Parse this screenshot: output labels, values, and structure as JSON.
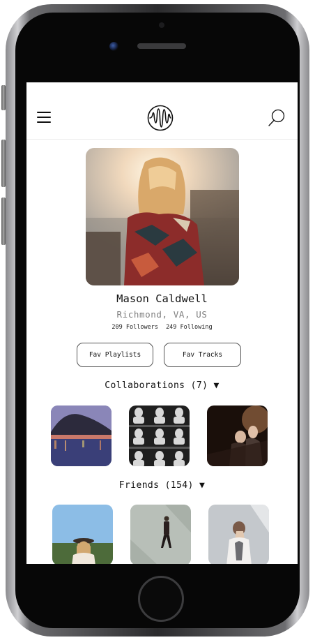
{
  "profile": {
    "name": "Mason Caldwell",
    "location": "Richmond, VA, US",
    "followers": "209 Followers",
    "following": "249 Following"
  },
  "buttons": {
    "fav_playlists": "Fav Playlists",
    "fav_tracks": "Fav Tracks"
  },
  "collaborations": {
    "title": "Collaborations (7) ▼",
    "items": [
      "lake-city-night",
      "statue-busts",
      "concert-crowd"
    ]
  },
  "friends": {
    "title": "Friends (154) ▼",
    "items": [
      "woman-hat-sky",
      "man-walking-street",
      "woman-grey-sky"
    ]
  },
  "icons": {
    "menu": "hamburger-menu-icon",
    "logo": "soundwave-logo-icon",
    "search": "search-icon"
  },
  "colors": {
    "text": "#111111",
    "muted": "#7d7d7d",
    "border": "#555555"
  }
}
